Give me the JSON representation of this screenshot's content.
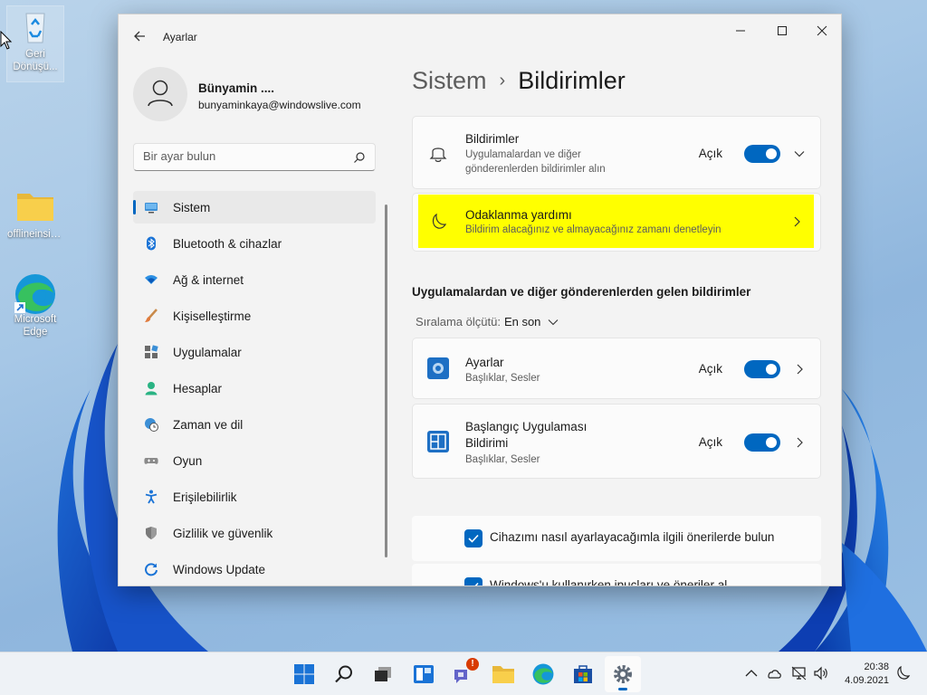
{
  "desktop": {
    "icons": [
      {
        "label": "Geri Dönüşü..."
      },
      {
        "label": "offlineinsid..."
      },
      {
        "label": "Microsoft Edge"
      }
    ]
  },
  "window": {
    "title": "Ayarlar",
    "profile": {
      "name": "Bünyamin ....",
      "email": "bunyaminkaya@windowslive.com"
    },
    "search": {
      "placeholder": "Bir ayar bulun"
    },
    "nav": [
      {
        "label": "Sistem",
        "icon": "monitor-icon",
        "active": true
      },
      {
        "label": "Bluetooth & cihazlar",
        "icon": "bluetooth-icon"
      },
      {
        "label": "Ağ & internet",
        "icon": "wifi-icon"
      },
      {
        "label": "Kişiselleştirme",
        "icon": "brush-icon"
      },
      {
        "label": "Uygulamalar",
        "icon": "apps-icon"
      },
      {
        "label": "Hesaplar",
        "icon": "person-icon"
      },
      {
        "label": "Zaman ve dil",
        "icon": "globe-clock-icon"
      },
      {
        "label": "Oyun",
        "icon": "gamepad-icon"
      },
      {
        "label": "Erişilebilirlik",
        "icon": "accessibility-icon"
      },
      {
        "label": "Gizlilik ve güvenlik",
        "icon": "shield-icon"
      },
      {
        "label": "Windows Update",
        "icon": "update-icon"
      }
    ],
    "breadcrumb": {
      "parent": "Sistem",
      "separator": "›",
      "current": "Bildirimler"
    },
    "notifications_card": {
      "title": "Bildirimler",
      "desc_line1": "Uygulamalardan ve diğer",
      "desc_line2": "gönderenlerden bildirimler alın",
      "state": "Açık",
      "toggle_on": true
    },
    "focus_card": {
      "title": "Odaklanma yardımı",
      "desc": "Bildirim alacağınız ve almayacağınız zamanı denetleyin"
    },
    "section_title": "Uygulamalardan ve diğer gönderenlerden gelen bildirimler",
    "sort": {
      "label": "Sıralama ölçütü:",
      "value": "En son"
    },
    "apps": [
      {
        "name": "Ayarlar",
        "sub": "Başlıklar, Sesler",
        "state": "Açık",
        "toggle_on": true
      },
      {
        "name_line1": "Başlangıç Uygulaması",
        "name_line2": "Bildirimi",
        "sub": "Başlıklar, Sesler",
        "state": "Açık",
        "toggle_on": true
      }
    ],
    "checkboxes": [
      {
        "label": "Cihazımı nasıl ayarlayacağımla ilgili önerilerde bulun",
        "checked": true
      },
      {
        "label": "Windows'u kullanırken ipuçları ve öneriler al",
        "checked": true
      }
    ]
  },
  "taskbar": {
    "clock": {
      "time": "20:38",
      "date": "4.09.2021"
    },
    "chat_badge": "!"
  },
  "colors": {
    "accent": "#0067c0",
    "highlight": "#ffff00"
  }
}
